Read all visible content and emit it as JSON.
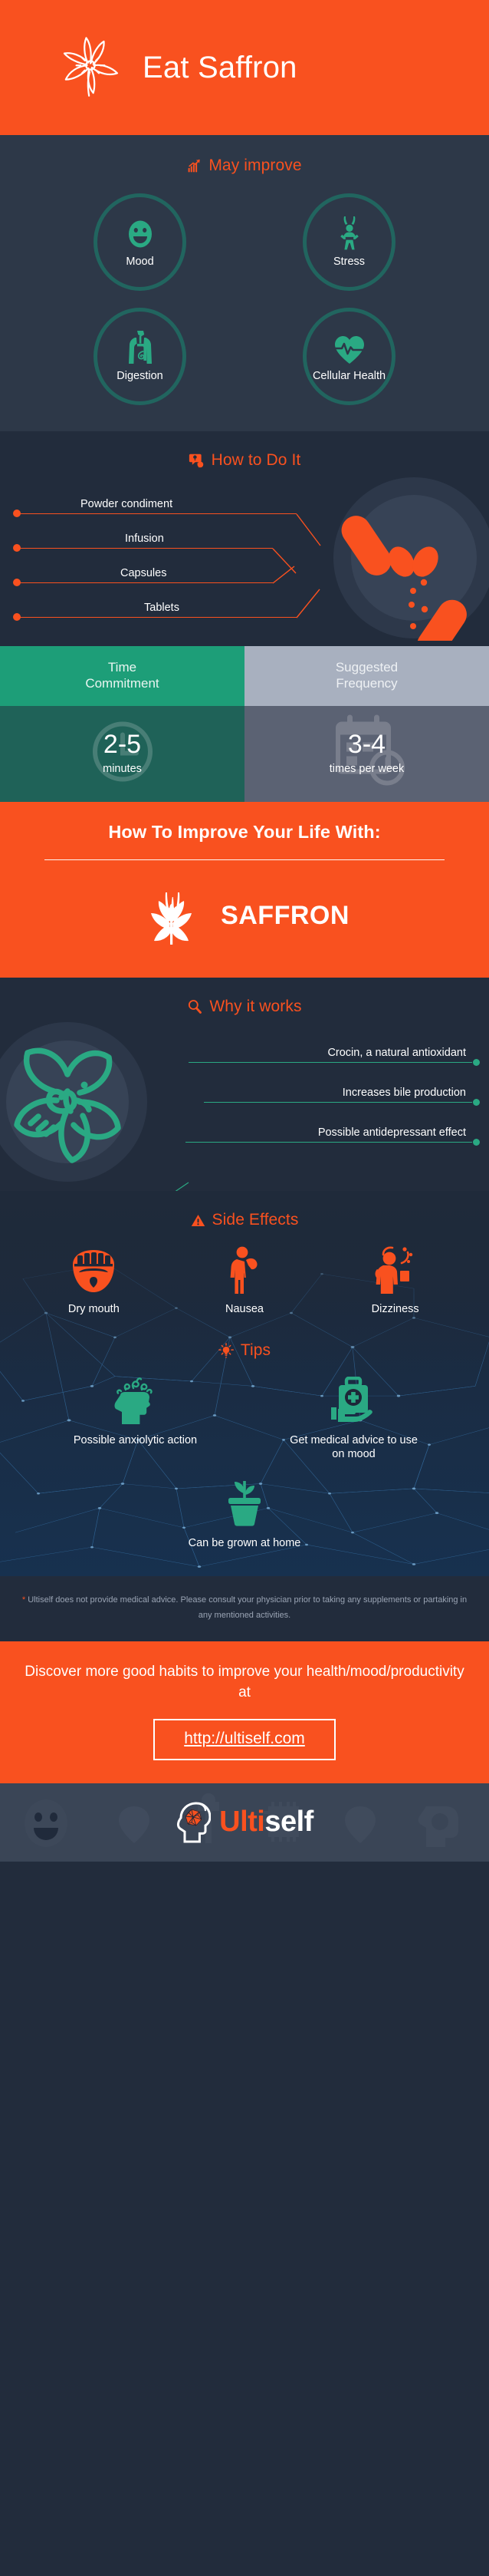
{
  "colors": {
    "orange": "#f9511f",
    "teal": "#2aa983",
    "teal_dark": "#21655f",
    "navy": "#222c3c",
    "navy_light": "#2d3848",
    "grey_head": "#a8b0bf"
  },
  "header": {
    "title": "Eat Saffron",
    "icon": "saffron-flower-outline-icon"
  },
  "may_improve": {
    "title": "May improve",
    "icon": "growth-chart-icon",
    "items": [
      {
        "label": "Mood",
        "icon": "smiley-face-icon"
      },
      {
        "label": "Stress",
        "icon": "stress-person-icon"
      },
      {
        "label": "Digestion",
        "icon": "digestive-system-icon"
      },
      {
        "label": "Cellular Health",
        "icon": "heart-pulse-icon"
      }
    ]
  },
  "how_to_do_it": {
    "title": "How to Do It",
    "icon": "question-speech-bubble-icon",
    "art_icon": "pills-capsules-icon",
    "items": [
      {
        "label": "Powder condiment"
      },
      {
        "label": "Infusion"
      },
      {
        "label": "Capsules"
      },
      {
        "label": "Tablets"
      }
    ]
  },
  "table": {
    "columns": [
      {
        "header": "Time\nCommitment",
        "header_line1": "Time",
        "header_line2": "Commitment",
        "value": "2-5",
        "unit": "minutes",
        "bg_icon": "clock-icon"
      },
      {
        "header": "Suggested\nFrequency",
        "header_line1": "Suggested",
        "header_line2": "Frequency",
        "value": "3-4",
        "unit": "times per week",
        "bg_icon": "calendar-clock-icon"
      }
    ]
  },
  "banner": {
    "title": "How To Improve Your Life With:",
    "brand": "SAFFRON",
    "icon": "saffron-flower-solid-icon"
  },
  "why_it_works": {
    "title": "Why it works",
    "icon": "magnifier-icon",
    "art_icon": "saffron-flower-line-icon",
    "items": [
      {
        "label": "Crocin, a natural antioxidant"
      },
      {
        "label": "Increases bile production"
      },
      {
        "label": "Possible antidepressant effect"
      }
    ]
  },
  "side_effects": {
    "title": "Side Effects",
    "icon": "warning-triangle-icon",
    "items": [
      {
        "label": "Dry mouth",
        "icon": "open-mouth-icon"
      },
      {
        "label": "Nausea",
        "icon": "nauseous-person-icon"
      },
      {
        "label": "Dizziness",
        "icon": "dizzy-person-icon"
      }
    ]
  },
  "tips": {
    "title": "Tips",
    "icon": "lightbulb-icon",
    "items": [
      {
        "label": "Possible anxiolytic action",
        "icon": "calm-mind-head-icon"
      },
      {
        "label": "Get medical advice to use on mood",
        "icon": "medical-kit-hand-icon"
      },
      {
        "label": "Can be grown at home",
        "icon": "potted-plant-icon"
      }
    ]
  },
  "disclaimer": {
    "star": "*",
    "text": "Ultiself does not provide medical advice. Please consult your physician prior to taking any supplements or partaking in any mentioned activities."
  },
  "cta": {
    "text": "Discover more good habits to improve your health/mood/productivity at",
    "button": "http://ultiself.com"
  },
  "footer": {
    "brand_orange": "Ulti",
    "brand_white": "self",
    "icon": "brain-head-logo-icon"
  }
}
